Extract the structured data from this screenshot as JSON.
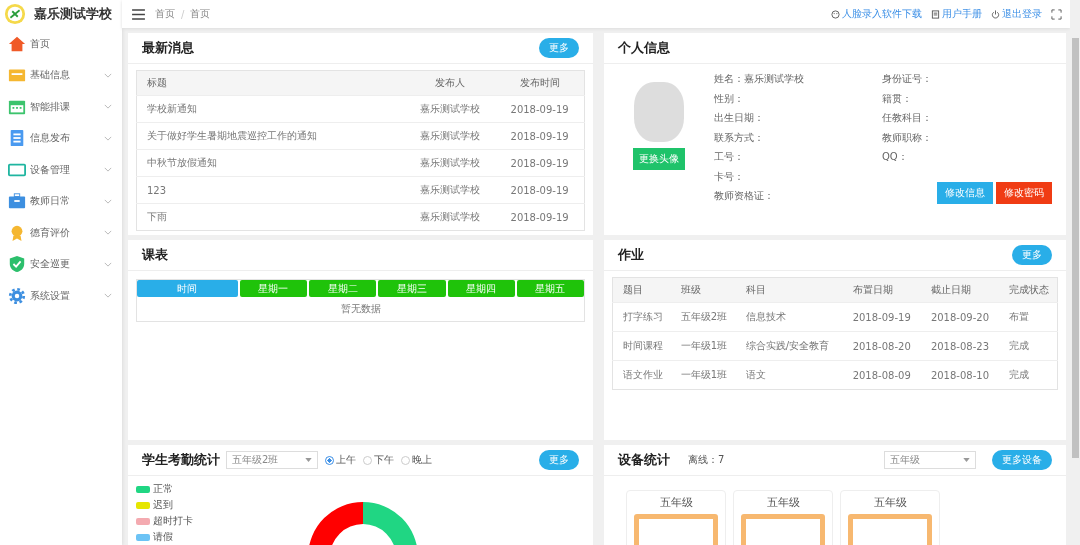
{
  "sidebar": {
    "school_name": "嘉乐测试学校",
    "items": [
      {
        "label": "首页",
        "expandable": false
      },
      {
        "label": "基础信息",
        "expandable": true
      },
      {
        "label": "智能排课",
        "expandable": true
      },
      {
        "label": "信息发布",
        "expandable": true
      },
      {
        "label": "设备管理",
        "expandable": true
      },
      {
        "label": "教师日常",
        "expandable": true
      },
      {
        "label": "德育评价",
        "expandable": true
      },
      {
        "label": "安全巡更",
        "expandable": true
      },
      {
        "label": "系统设置",
        "expandable": true
      }
    ]
  },
  "header": {
    "breadcrumb": [
      "首页",
      "首页"
    ],
    "separator": "/",
    "links": [
      "人脸录入软件下载",
      "用户手册",
      "退出登录"
    ]
  },
  "news": {
    "title": "最新消息",
    "more": "更多",
    "columns": [
      "标题",
      "发布人",
      "发布时间"
    ],
    "rows": [
      [
        "学校新通知",
        "嘉乐测试学校",
        "2018-09-19"
      ],
      [
        "关于做好学生暑期地震巡控工作的通知",
        "嘉乐测试学校",
        "2018-09-19"
      ],
      [
        "中秋节放假通知",
        "嘉乐测试学校",
        "2018-09-19"
      ],
      [
        "123",
        "嘉乐测试学校",
        "2018-09-19"
      ],
      [
        "下雨",
        "嘉乐测试学校",
        "2018-09-19"
      ]
    ]
  },
  "profile": {
    "title": "个人信息",
    "change_avatar": "更换头像",
    "left_fields": [
      "姓名：嘉乐测试学校",
      "性别：",
      "出生日期：",
      "联系方式：",
      "工号：",
      "卡号：",
      "教师资格证："
    ],
    "right_fields": [
      "身份证号：",
      "籍贯：",
      "任教科目：",
      "教师职称：",
      "QQ："
    ],
    "buttons": [
      {
        "label": "修改信息",
        "kind": "primary"
      },
      {
        "label": "修改密码",
        "kind": "danger"
      }
    ]
  },
  "timetable": {
    "title": "课表",
    "columns": [
      {
        "label": "时间",
        "kind": "time"
      },
      {
        "label": "星期一",
        "kind": "day"
      },
      {
        "label": "星期二",
        "kind": "day"
      },
      {
        "label": "星期三",
        "kind": "day"
      },
      {
        "label": "星期四",
        "kind": "day"
      },
      {
        "label": "星期五",
        "kind": "day"
      }
    ],
    "empty": "暂无数据"
  },
  "homework": {
    "title": "作业",
    "more": "更多",
    "columns": [
      "题目",
      "班级",
      "科目",
      "布置日期",
      "截止日期",
      "完成状态"
    ],
    "rows": [
      [
        "打字练习",
        "五年级2班",
        "信息技术",
        "2018-09-19",
        "2018-09-20",
        "布置"
      ],
      [
        "时间课程",
        "一年级1班",
        "综合实践/安全教育",
        "2018-08-20",
        "2018-08-23",
        "完成"
      ],
      [
        "语文作业",
        "一年级1班",
        "语文",
        "2018-08-09",
        "2018-08-10",
        "完成"
      ]
    ]
  },
  "attendance": {
    "title": "学生考勤统计",
    "class_select": "五年级2班",
    "periods": [
      {
        "label": "上午",
        "selected": true
      },
      {
        "label": "下午",
        "selected": false
      },
      {
        "label": "晚上",
        "selected": false
      }
    ],
    "more": "更多",
    "legend": [
      {
        "label": "正常",
        "color": "#20d683"
      },
      {
        "label": "迟到",
        "color": "#e6e600"
      },
      {
        "label": "超时打卡",
        "color": "#f4aab0"
      },
      {
        "label": "请假",
        "color": "#6cc3f5"
      }
    ]
  },
  "devices": {
    "title": "设备统计",
    "offline": "离线：7",
    "grade_select": "五年级",
    "more": "更多设备",
    "cards": [
      "五年级",
      "五年级",
      "五年级"
    ]
  }
}
